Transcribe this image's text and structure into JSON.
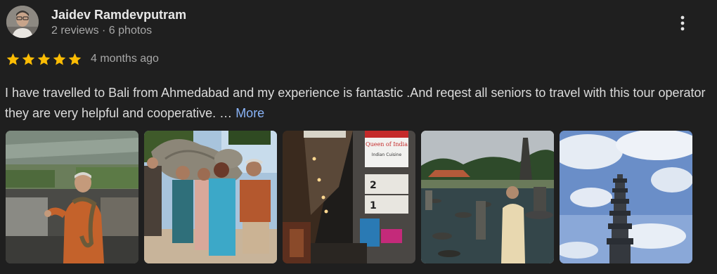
{
  "author": {
    "name": "Jaidev Ramdevputram",
    "meta": "2 reviews · 6 photos",
    "avatar_icon": "profile-photo"
  },
  "rating": {
    "stars": 5,
    "max_stars": 5,
    "star_color": "#fbbc04",
    "time_ago": "4 months ago"
  },
  "review": {
    "text": "I have travelled to Bali from Ahmedabad and my experience is fantastic .And reqest all seniors to travel with this tour operator they are very helpful and cooperative. … ",
    "more_label": "More"
  },
  "photos": [
    {
      "name": "photo-man-with-snake",
      "icon": "photo"
    },
    {
      "name": "photo-group-with-turtle-statue",
      "icon": "photo"
    },
    {
      "name": "photo-restaurant-street-at-night",
      "icon": "photo"
    },
    {
      "name": "photo-man-at-water-garden",
      "icon": "photo"
    },
    {
      "name": "photo-pagoda-tower-sky",
      "icon": "photo"
    }
  ],
  "signage": {
    "sign_top": "Queen of India",
    "sign_sub": "Indian Cuisine",
    "floor_up": "2",
    "floor_down": "1"
  },
  "colors": {
    "background": "#1f1f1f",
    "link": "#8ab4f8",
    "star": "#fbbc04"
  },
  "more_options_icon": "vertical-dots-icon"
}
